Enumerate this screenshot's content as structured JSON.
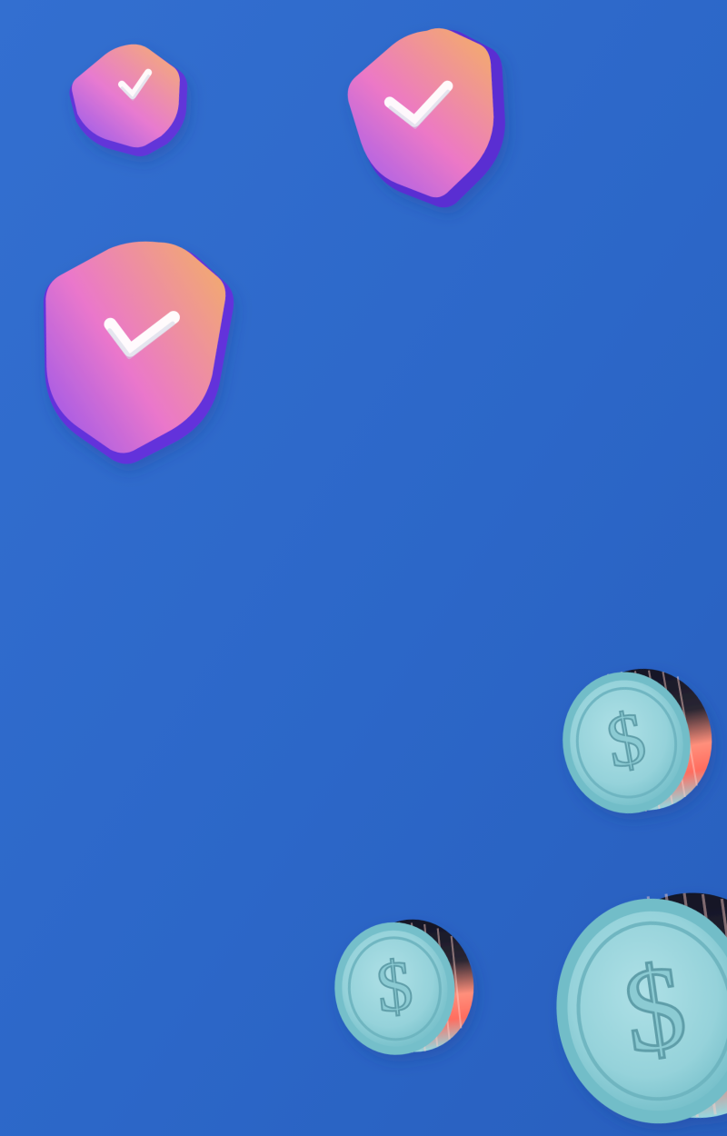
{
  "scene": {
    "background_color": "#2c67c8",
    "background_color_light": "#336fd0",
    "background_color_dark": "#285fbe"
  },
  "shields": [
    {
      "icon": "shield-check-icon",
      "gradient": [
        "#f6b26b",
        "#e77ad0",
        "#8d56f0"
      ],
      "side": "#6f35d5"
    },
    {
      "icon": "shield-check-icon",
      "gradient": [
        "#f4b063",
        "#ec78c6",
        "#9a5bf1"
      ],
      "side": "#5e2fd4"
    },
    {
      "icon": "shield-check-icon",
      "gradient": [
        "#f3b064",
        "#ea77cb",
        "#8d52ef"
      ],
      "side": "#5f35db"
    }
  ],
  "coins": [
    {
      "icon": "dollar-coin-icon",
      "face": "#9fd6dd",
      "rim": "#7ec5cf",
      "edge_highlight": "#ff8f7b",
      "edge_dark": "#1b1b2d"
    },
    {
      "icon": "dollar-coin-icon",
      "face": "#a6d9df",
      "rim": "#86cad3",
      "edge_highlight": "#ff907d",
      "edge_dark": "#1a1c2d"
    },
    {
      "icon": "dollar-coin-icon",
      "face": "#a1d6dd",
      "rim": "#80c8d1",
      "edge_highlight": "#ff8c77",
      "edge_dark": "#191b2b"
    }
  ]
}
